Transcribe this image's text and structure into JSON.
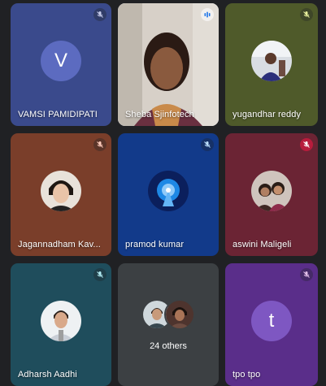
{
  "participants": [
    {
      "name": "VAMSI PAMIDIPATI",
      "initial": "V",
      "mic": "mic-off-icon"
    },
    {
      "name": "Sheba Sjinfotech",
      "mic": "speaking-indicator-icon"
    },
    {
      "name": "yugandhar reddy",
      "mic": "mic-off-icon"
    },
    {
      "name": "Jagannadham Kav...",
      "mic": "mic-off-icon"
    },
    {
      "name": "pramod kumar",
      "mic": "mic-off-icon"
    },
    {
      "name": "aswini Maligeli",
      "mic": "mic-off-icon"
    },
    {
      "name": "Adharsh Aadhi",
      "mic": "mic-off-icon"
    },
    {
      "name": "tpo tpo",
      "initial": "t",
      "mic": "mic-off-icon"
    }
  ],
  "others": {
    "label": "24 others"
  },
  "colors": {
    "background": "#202124",
    "tile_vamsi": "#3a4a8c",
    "tile_yugandhar": "#4f5a2a",
    "tile_jagannadham": "#7a3e2a",
    "tile_pramod": "#123a8a",
    "tile_aswini": "#6b2434",
    "tile_adharsh": "#1f4d5c",
    "tile_others": "#3c4043",
    "tile_tpo": "#5a2e8a",
    "avatar_v": "#5c6bc0",
    "avatar_t": "#7e57c2",
    "speaking_outline": "#8ab4f8"
  }
}
